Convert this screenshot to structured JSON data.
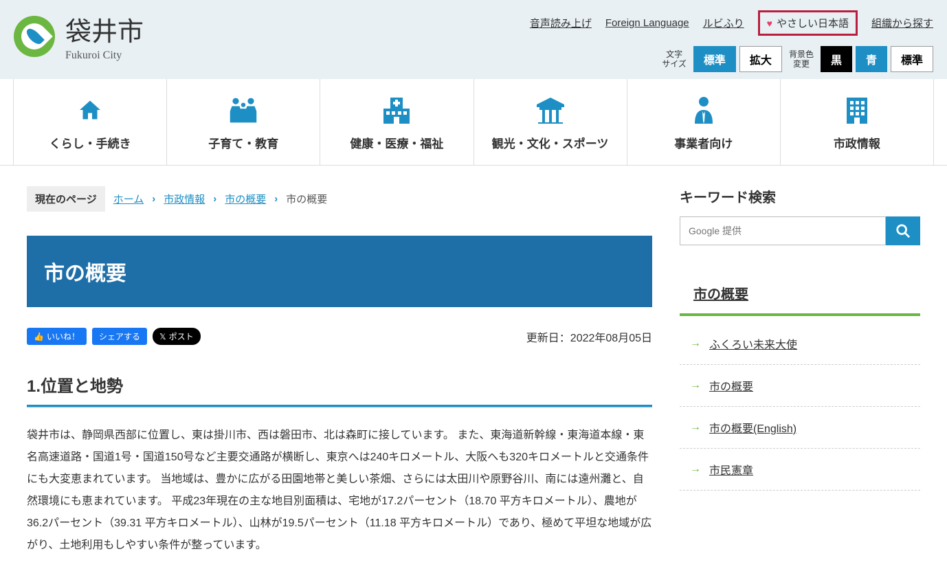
{
  "header": {
    "city_name": "袋井市",
    "city_en": "Fukuroi City",
    "links": {
      "voice": "音声読み上げ",
      "foreign": "Foreign Language",
      "ruby": "ルビふり",
      "easy_jp": "やさしい日本語",
      "org": "組織から探す"
    },
    "font_label": "文字\nサイズ",
    "font_std": "標準",
    "font_big": "拡大",
    "bg_label": "背景色\n変更",
    "bg_black": "黒",
    "bg_blue": "青",
    "bg_std": "標準"
  },
  "nav": [
    {
      "label": "くらし・手続き"
    },
    {
      "label": "子育て・教育"
    },
    {
      "label": "健康・医療・福祉"
    },
    {
      "label": "観光・文化・スポーツ"
    },
    {
      "label": "事業者向け"
    },
    {
      "label": "市政情報"
    }
  ],
  "breadcrumb": {
    "label": "現在のページ",
    "items": [
      "ホーム",
      "市政情報",
      "市の概要"
    ],
    "current": "市の概要"
  },
  "page": {
    "title": "市の概要",
    "fb_like": "いいね！",
    "fb_share": "シェアする",
    "x_post": "ポスト",
    "update": "更新日：2022年08月05日",
    "section1_h": "1.位置と地勢",
    "section1_body": "袋井市は、静岡県西部に位置し、東は掛川市、西は磐田市、北は森町に接しています。 また、東海道新幹線・東海道本線・東名高速道路・国道1号・国道150号など主要交通路が横断し、東京へは240キロメートル、大阪へも320キロメートルと交通条件にも大変恵まれています。 当地域は、豊かに広がる田園地帯と美しい茶畑、さらには太田川や原野谷川、南には遠州灘と、自然環境にも恵まれています。 平成23年現在の主な地目別面積は、宅地が17.2パーセント（18.70 平方キロメートル）、農地が36.2パーセント（39.31 平方キロメートル）、山林が19.5パーセント（11.18 平方キロメートル）であり、極めて平坦な地域が広がり、土地利用もしやすい条件が整っています。"
  },
  "sidebar": {
    "search_h": "キーワード検索",
    "search_ph": "Google 提供",
    "title": "市の概要",
    "links": [
      "ふくろい未来大使",
      "市の概要",
      "市の概要(English)",
      "市民憲章"
    ]
  }
}
